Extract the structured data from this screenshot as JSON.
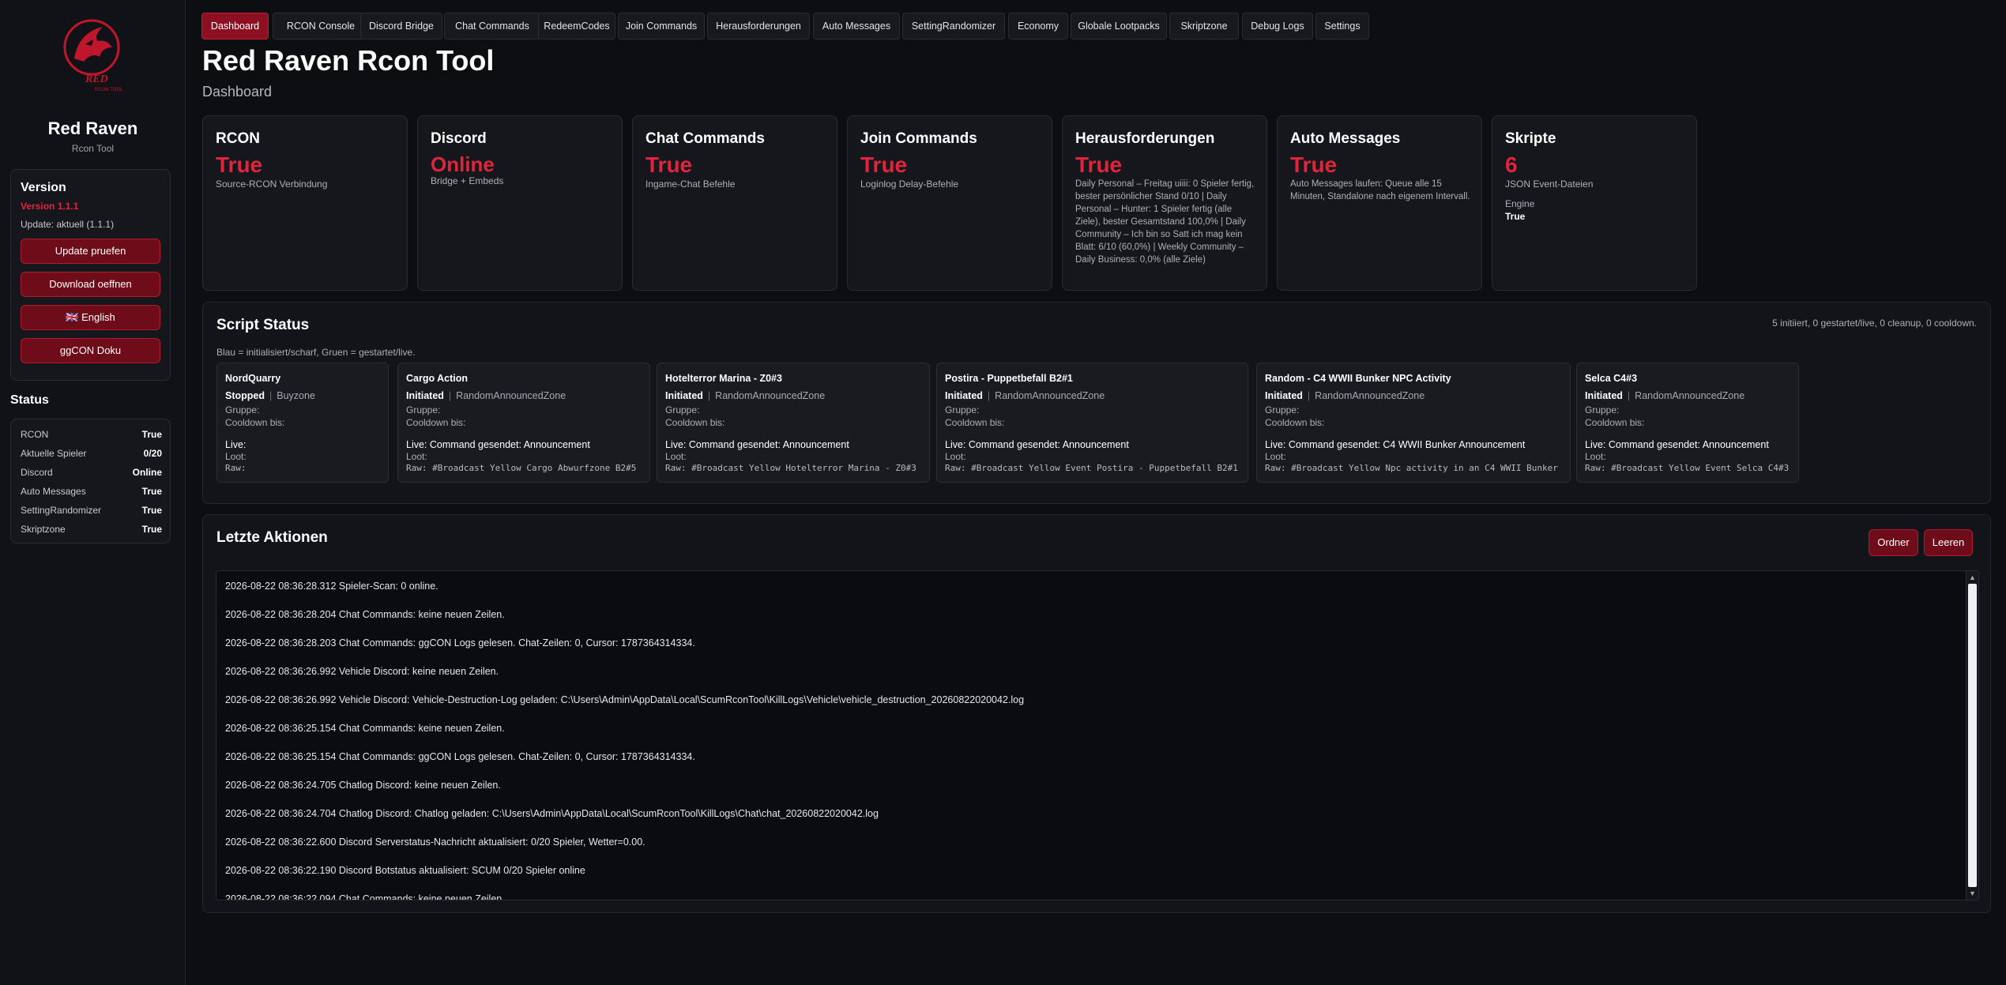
{
  "sidebar": {
    "logo_text": "RED",
    "logo_sub": "RCON TOOL",
    "brand_name": "Red Raven",
    "brand_sub": "Rcon Tool",
    "version": {
      "title": "Version",
      "version": "Version 1.1.1",
      "update": "Update: aktuell (1.1.1)",
      "buttons": [
        "Update pruefen",
        "Download oeffnen",
        "🇬🇧 English",
        "ggCON Doku"
      ]
    },
    "status": {
      "title": "Status",
      "rows": [
        {
          "k": "RCON",
          "v": "True"
        },
        {
          "k": "Aktuelle Spieler",
          "v": "0/20"
        },
        {
          "k": "Discord",
          "v": "Online"
        },
        {
          "k": "Auto Messages",
          "v": "True"
        },
        {
          "k": "SettingRandomizer",
          "v": "True"
        },
        {
          "k": "Skriptzone",
          "v": "True"
        }
      ]
    }
  },
  "tabs": [
    "Dashboard",
    "RCON Console",
    "Discord Bridge",
    "Chat Commands",
    "RedeemCodes",
    "Join Commands",
    "Herausforderungen",
    "Auto Messages",
    "SettingRandomizer",
    "Economy",
    "Globale Lootpacks",
    "Skriptzone",
    "Debug Logs",
    "Settings"
  ],
  "header": {
    "title": "Red Raven Rcon Tool",
    "subtitle": "Dashboard"
  },
  "cards": [
    {
      "title": "RCON",
      "value": "True",
      "desc": "Source-RCON Verbindung"
    },
    {
      "title": "Discord",
      "value": "Online",
      "desc": "Bridge + Embeds"
    },
    {
      "title": "Chat Commands",
      "value": "True",
      "desc": "Ingame-Chat Befehle"
    },
    {
      "title": "Join Commands",
      "value": "True",
      "desc": "Loginlog Delay-Befehle"
    },
    {
      "title": "Herausforderungen",
      "value": "True",
      "desc": "Daily Personal – Freitag uiiii: 0 Spieler fertig, bester persönlicher Stand 0/10 | Daily Personal – Hunter: 1 Spieler fertig (alle Ziele), bester Gesamtstand 100,0% | Daily Community – Ich bin so Satt ich mag kein Blatt: 6/10 (60,0%) | Weekly Community – Daily Business: 0,0% (alle Ziele)"
    },
    {
      "title": "Auto Messages",
      "value": "True",
      "desc": "Auto Messages laufen: Queue alle 15 Minuten, Standalone nach eigenem Intervall."
    },
    {
      "title": "Skripte",
      "value": "6",
      "desc": "JSON Event-Dateien",
      "extra_label": "Engine",
      "extra_value": "True"
    }
  ],
  "script_status": {
    "title": "Script Status",
    "summary": "5 initiiert, 0 gestartet/live, 0 cleanup, 0 cooldown.",
    "legend": "Blau = initialisiert/scharf, Gruen = gestartet/live.",
    "group_label": "Gruppe:",
    "cooldown_label": "Cooldown bis:",
    "loot_label": "Loot:",
    "scripts": [
      {
        "name": "NordQuarry",
        "state": "Stopped",
        "zone": "Buyzone",
        "live": "Live:",
        "raw": "Raw:"
      },
      {
        "name": "Cargo Action",
        "state": "Initiated",
        "zone": "RandomAnnouncedZone",
        "live": "Live: Command gesendet: Announcement",
        "raw": "Raw: #Broadcast Yellow Cargo Abwurfzone B2#5"
      },
      {
        "name": "Hotelterror Marina - Z0#3",
        "state": "Initiated",
        "zone": "RandomAnnouncedZone",
        "live": "Live: Command gesendet: Announcement",
        "raw": "Raw: #Broadcast Yellow Hotelterror Marina - Z0#3"
      },
      {
        "name": "Postira - Puppetbefall B2#1",
        "state": "Initiated",
        "zone": "RandomAnnouncedZone",
        "live": "Live: Command gesendet: Announcement",
        "raw": "Raw: #Broadcast Yellow Event Postira - Puppetbefall B2#1"
      },
      {
        "name": "Random - C4 WWII Bunker NPC Activity",
        "state": "Initiated",
        "zone": "RandomAnnouncedZone",
        "live": "Live: Command gesendet: C4 WWII Bunker Announcement",
        "raw": "Raw: #Broadcast Yellow Npc activity in an C4 WWII Bunker"
      },
      {
        "name": "Selca C4#3",
        "state": "Initiated",
        "zone": "RandomAnnouncedZone",
        "live": "Live: Command gesendet: Announcement",
        "raw": "Raw: #Broadcast Yellow Event Selca C4#3"
      }
    ]
  },
  "actions": {
    "title": "Letzte Aktionen",
    "btn_folder": "Ordner",
    "btn_clear": "Leeren",
    "log": [
      "2026-08-22 08:36:28.312  Spieler-Scan: 0 online.",
      "2026-08-22 08:36:28.204  Chat Commands: keine neuen Zeilen.",
      "2026-08-22 08:36:28.203  Chat Commands: ggCON Logs gelesen. Chat-Zeilen: 0, Cursor: 1787364314334.",
      "2026-08-22 08:36:26.992  Vehicle Discord: keine neuen Zeilen.",
      "2026-08-22 08:36:26.992  Vehicle Discord: Vehicle-Destruction-Log geladen: C:\\Users\\Admin\\AppData\\Local\\ScumRconTool\\KillLogs\\Vehicle\\vehicle_destruction_20260822020042.log",
      "2026-08-22 08:36:25.154  Chat Commands: keine neuen Zeilen.",
      "2026-08-22 08:36:25.154  Chat Commands: ggCON Logs gelesen. Chat-Zeilen: 0, Cursor: 1787364314334.",
      "2026-08-22 08:36:24.705  Chatlog Discord: keine neuen Zeilen.",
      "2026-08-22 08:36:24.704  Chatlog Discord: Chatlog geladen: C:\\Users\\Admin\\AppData\\Local\\ScumRconTool\\KillLogs\\Chat\\chat_20260822020042.log",
      "2026-08-22 08:36:22.600  Discord Serverstatus-Nachricht aktualisiert: 0/20 Spieler, Wetter=0.00.",
      "2026-08-22 08:36:22.190  Discord Botstatus aktualisiert: SCUM 0/20 Spieler online",
      "2026-08-22 08:36:22.094  Chat Commands: keine neuen Zeilen."
    ]
  }
}
